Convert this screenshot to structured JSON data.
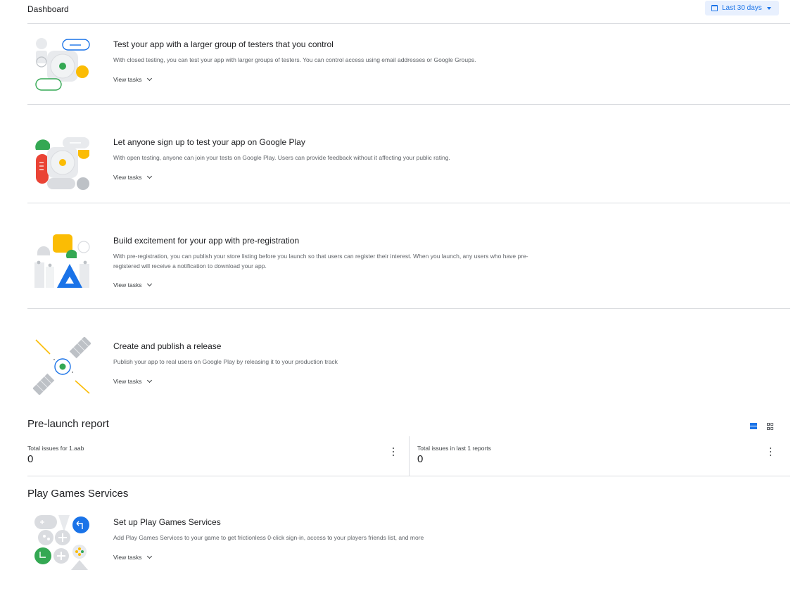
{
  "header": {
    "title": "Dashboard",
    "date_range": "Last 30 days"
  },
  "tasks": [
    {
      "title": "Test your app with a larger group of testers that you control",
      "description": "With closed testing, you can test your app with larger groups of testers. You can control access using email addresses or Google Groups.",
      "link": "View tasks"
    },
    {
      "title": "Let anyone sign up to test your app on Google Play",
      "description": "With open testing, anyone can join your tests on Google Play. Users can provide feedback without it affecting your public rating.",
      "link": "View tasks"
    },
    {
      "title": "Build excitement for your app with pre-registration",
      "description": "With pre-registration, you can publish your store listing before you launch so that users can register their interest. When you launch, any users who have pre-registered will receive a notification to download your app.",
      "link": "View tasks"
    },
    {
      "title": "Create and publish a release",
      "description": "Publish your app to real users on Google Play by releasing it to your production track",
      "link": "View tasks"
    }
  ],
  "prelaunch": {
    "title": "Pre-launch report",
    "metrics": [
      {
        "label": "Total issues for 1.aab",
        "value": "0"
      },
      {
        "label": "Total issues in last 1 reports",
        "value": "0"
      }
    ]
  },
  "games": {
    "title": "Play Games Services",
    "task": {
      "title": "Set up Play Games Services",
      "description": "Add Play Games Services to your game to get frictionless 0-click sign-in, access to your players friends list, and more",
      "link": "View tasks"
    }
  },
  "colors": {
    "accent": "#1a73e8",
    "green": "#34a853",
    "yellow": "#fbbc04",
    "red": "#ea4335",
    "grey": "#dadce0"
  },
  "icons": {
    "date_button": "calendar-icon",
    "date_caret": "caret-down-icon",
    "view_list": "list-view-icon",
    "view_grid": "grid-view-icon",
    "metric_menu": "more-vert-icon",
    "task_link": "chevron-down-icon"
  }
}
